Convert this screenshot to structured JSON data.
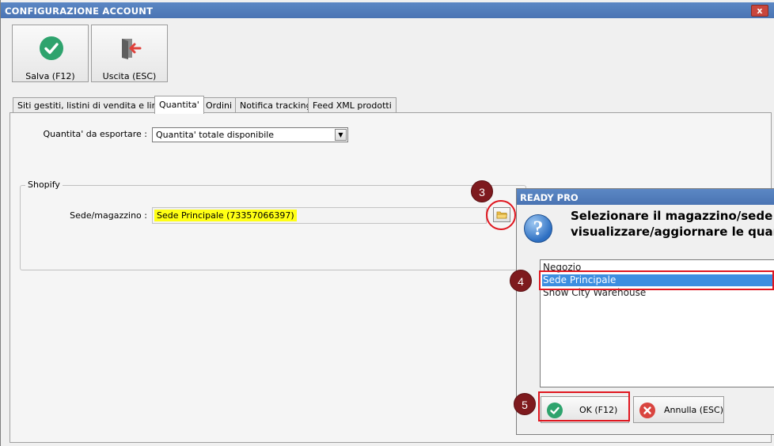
{
  "window": {
    "title": "CONFIGURAZIONE ACCOUNT",
    "close_glyph": "x"
  },
  "toolbar": {
    "save_label": "Salva (F12)",
    "exit_label": "Uscita (ESC)"
  },
  "tabs": [
    {
      "label": "Siti gestiti, listini di vendita e lingue",
      "active": false
    },
    {
      "label": "Quantita'",
      "active": true
    },
    {
      "label": "Ordini",
      "active": false
    },
    {
      "label": "Notifica tracking",
      "active": false
    },
    {
      "label": "Feed XML prodotti",
      "active": false
    }
  ],
  "quantity": {
    "label": "Quantita' da esportare :",
    "selected": "Quantita' totale disponibile"
  },
  "shopify": {
    "group_label": "Shopify",
    "location_label": "Sede/magazzino :",
    "location_value": "Sede Principale (73357066397)"
  },
  "dialog": {
    "title": "READY PRO",
    "icon": "question-icon",
    "message_line1": "Selezionare il magazzino/sede Shopify da",
    "message_line2": "visualizzare/aggiornare le quantita'",
    "items": [
      "Negozio",
      "Sede Principale",
      "Snow City Warehouse"
    ],
    "selected_item": "Sede Principale",
    "ok_label": "OK (F12)",
    "cancel_label": "Annulla (ESC)"
  },
  "annotations": [
    "3",
    "4",
    "5"
  ],
  "colors": {
    "titlebar": "#4f7bbb",
    "highlight": "#ffff14",
    "annotation_badge": "#7e1a1e",
    "annotation_ring": "#e0161f",
    "selection": "#3d8ee0",
    "ok_green": "#2ea36d",
    "cancel_red": "#d9443f"
  }
}
